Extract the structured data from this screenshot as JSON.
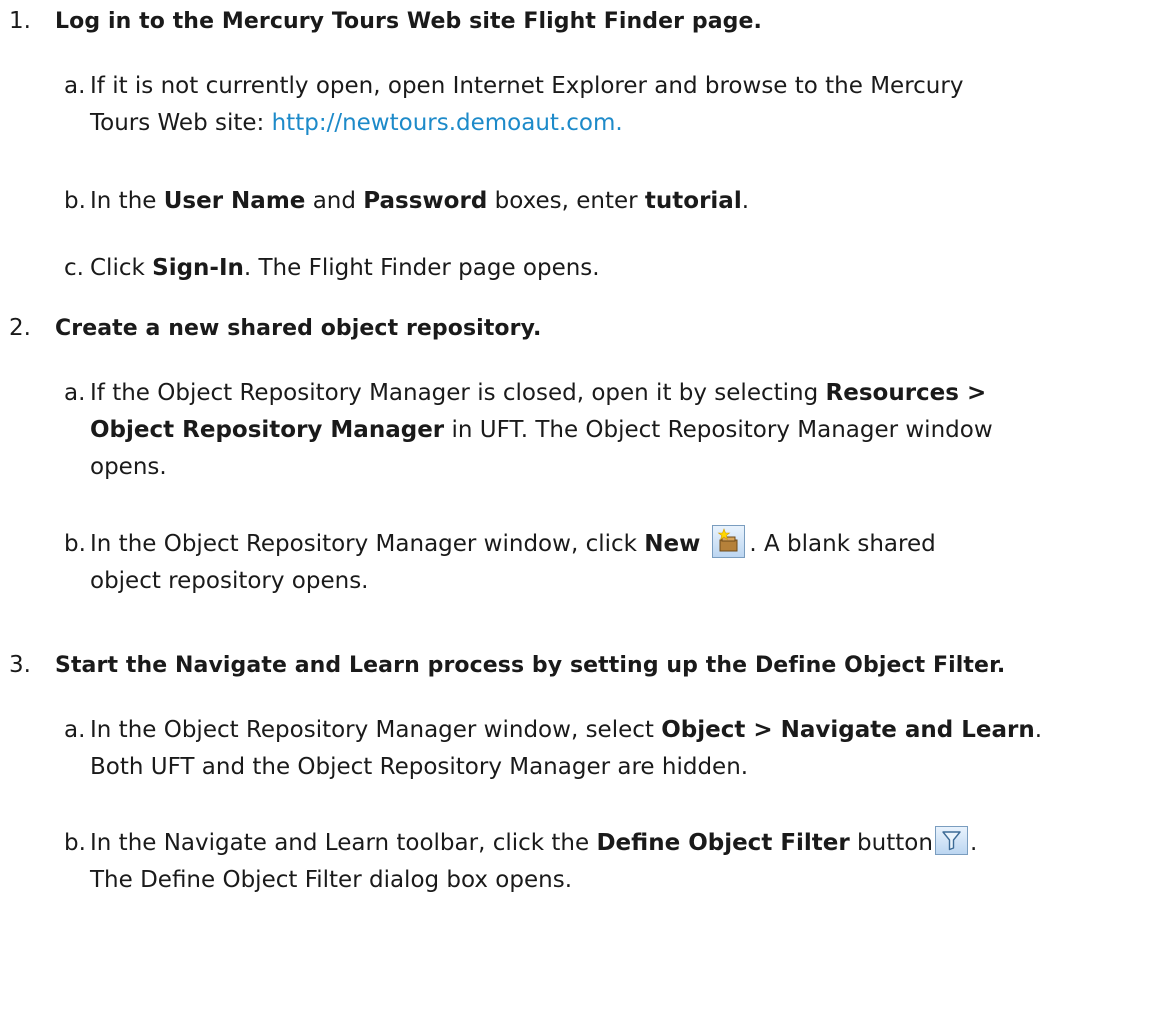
{
  "steps": [
    {
      "number": "1.",
      "title": "Log in to the Mercury Tours Web site Flight Finder page.",
      "a": {
        "letter": "a.",
        "text1": "If it is not currently open, open Internet Explorer and browse to the Mercury",
        "text2": "Tours Web site: ",
        "link": "http://newtours.demoaut.com."
      },
      "b": {
        "letter": "b.",
        "t1": "In the ",
        "b1": "User Name",
        "t2": " and ",
        "b2": "Password",
        "t3": " boxes, enter ",
        "b3": "tutorial",
        "t4": "."
      },
      "c": {
        "letter": "c.",
        "t1": "Click ",
        "b1": "Sign-In",
        "t2": ". The Flight Finder page opens."
      }
    },
    {
      "number": "2.",
      "title": "Create a new shared object repository.",
      "a": {
        "letter": "a.",
        "t1": "If the Object Repository Manager is closed, open it by selecting ",
        "b1": "Resources >",
        "b2": "Object Repository Manager",
        "t2": " in UFT. The Object Repository Manager window",
        "t3": "opens."
      },
      "b": {
        "letter": "b.",
        "t1": "In the Object Repository Manager window, click ",
        "b1": "New",
        "icon": "new-repository-icon",
        "t2": ". A blank shared",
        "t3": "object repository opens."
      }
    },
    {
      "number": "3.",
      "title": "Start the Navigate and Learn process by setting up the Define Object Filter.",
      "a": {
        "letter": "a.",
        "t1": "In the Object Repository Manager window, select ",
        "b1": "Object > Navigate and Learn",
        "t2": ".",
        "t3": "Both UFT and the Object Repository Manager are hidden."
      },
      "b": {
        "letter": "b.",
        "t1": "In the Navigate and Learn toolbar, click the ",
        "b1": "Define Object Filter",
        "t2": " button",
        "icon": "filter-icon",
        "t3": ".",
        "t4": "The Define Object Filter dialog box opens."
      }
    }
  ],
  "colors": {
    "text": "#1a1a1a",
    "link": "#1d8ac9",
    "icon_border": "#7a9dbf"
  }
}
